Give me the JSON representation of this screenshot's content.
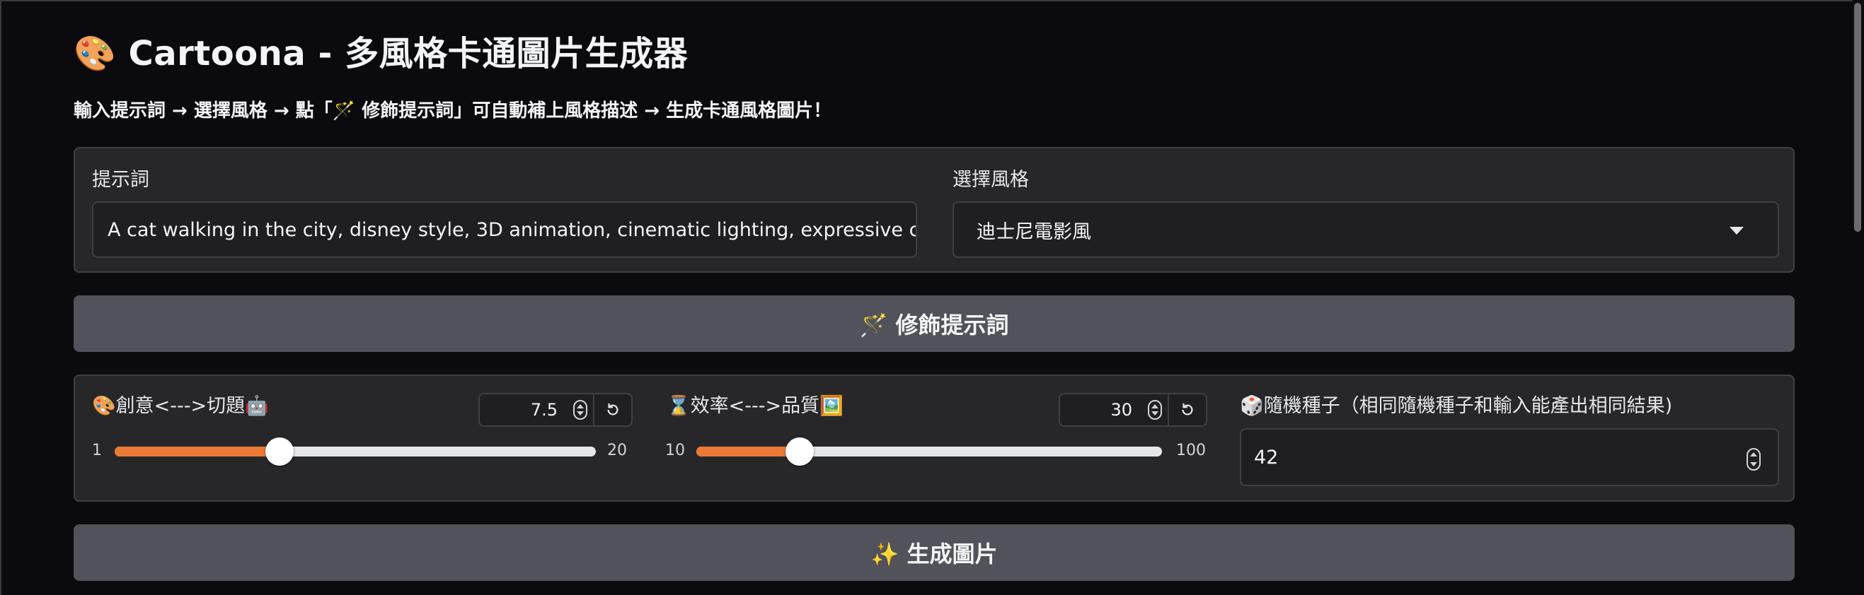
{
  "header": {
    "title": "🎨 Cartoona - 多風格卡通圖片生成器",
    "subtitle": "輸入提示詞 → 選擇風格 → 點「🪄 修飾提示詞」可自動補上風格描述 → 生成卡通風格圖片！"
  },
  "prompt": {
    "label": "提示詞",
    "value": "A cat walking in the city, disney style, 3D animation, cinematic lighting, expressive characters"
  },
  "style": {
    "label": "選擇風格",
    "selected": "迪士尼電影風"
  },
  "enhance_button": "🪄 修飾提示詞",
  "guidance": {
    "label": "🎨創意<--->切題🤖",
    "value": "7.5",
    "min": "1",
    "max": "20",
    "fraction": 0.342
  },
  "steps": {
    "label": "⌛效率<--->品質🖼️",
    "value": "30",
    "min": "10",
    "max": "100",
    "fraction": 0.222
  },
  "seed": {
    "label": "🎲隨機種子（相同隨機種子和輸入能產出相同結果)",
    "value": "42"
  },
  "generate_button": "✨ 生成圖片",
  "colors": {
    "accent": "#ea7a35",
    "background": "#0b0b0f",
    "panel": "#27272a",
    "button": "#52525b"
  }
}
